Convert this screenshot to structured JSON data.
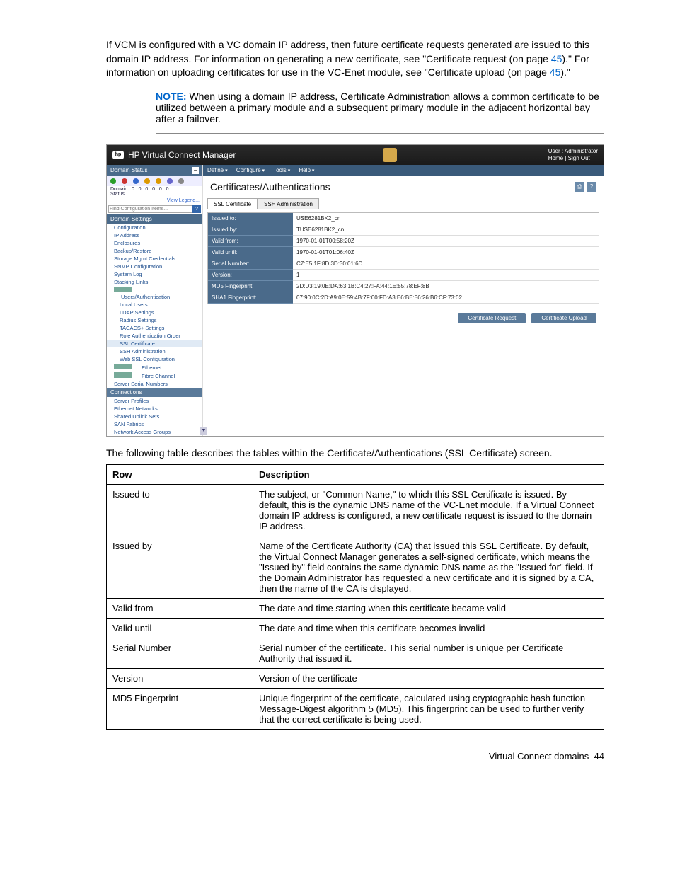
{
  "intro": {
    "p1a": "If VCM is configured with a VC domain IP address, then future certificate requests generated are issued to this domain IP address. For information on generating a new certificate, see \"Certificate request (on page ",
    "p1_ref1": "45",
    "p1b": ").\" For information on uploading certificates for use in the VC-Enet module, see \"Certificate upload (on page ",
    "p1_ref2": "45",
    "p1c": ").\""
  },
  "note": {
    "label": "NOTE:",
    "text": "  When using a domain IP address, Certificate Administration allows a common certificate to be utilized between a primary module and a subsequent primary module in the adjacent horizontal bay after a failover."
  },
  "shot": {
    "title": "HP Virtual Connect Manager",
    "user_label": "User : Administrator",
    "home": "Home",
    "signout": "Sign Out",
    "sidebar": {
      "status_hdr": "Domain Status",
      "domain_label": "Domain Status",
      "legend": "View Legend...",
      "search_ph": "Find Configuration Items...",
      "settings_hdr": "Domain Settings",
      "items": [
        "Configuration",
        "IP Address",
        "Enclosures",
        "Backup/Restore",
        "Storage Mgmt Credentials",
        "SNMP Configuration",
        "System Log",
        "Stacking Links"
      ],
      "users_hdr": "Users/Authentication",
      "users": [
        "Local Users",
        "LDAP Settings",
        "Radius Settings",
        "TACACS+ Settings",
        "Role Authentication Order",
        "SSL Certificate",
        "SSH Administration",
        "Web SSL Configuration"
      ],
      "eth": "Ethernet",
      "fc": "Fibre Channel",
      "ssn": "Server Serial Numbers",
      "conn_hdr": "Connections",
      "conn": [
        "Server Profiles",
        "Ethernet Networks",
        "Shared Uplink Sets",
        "SAN Fabrics",
        "Network Access Groups"
      ]
    },
    "menus": [
      "Define",
      "Configure",
      "Tools",
      "Help"
    ],
    "page_title": "Certificates/Authentications",
    "tabs": [
      "SSL Certificate",
      "SSH Administration"
    ],
    "cert": [
      {
        "l": "Issued to:",
        "v": "USE6281BK2_cn"
      },
      {
        "l": "Issued by:",
        "v": "TUSE6281BK2_cn"
      },
      {
        "l": "Valid from:",
        "v": "1970-01-01T00:58:20Z"
      },
      {
        "l": "Valid until:",
        "v": "1970-01-01T01:06:40Z"
      },
      {
        "l": "Serial Number:",
        "v": "C7:E5:1F:8D:3D:30:01:6D"
      },
      {
        "l": "Version:",
        "v": "1"
      },
      {
        "l": "MD5 Fingerprint:",
        "v": "2D:D3:19:0E:DA:63:1B:C4:27:FA:44:1E:55:78:EF:8B"
      },
      {
        "l": "SHA1 Fingerprint:",
        "v": "07:90:0C:2D:A9:0E:59:4B:7F:00:FD:A3:E6:BE:56:26:B6:CF:73:02"
      }
    ],
    "btn_req": "Certificate Request",
    "btn_up": "Certificate Upload"
  },
  "table_intro": "The following table describes the tables within the Certificate/Authentications (SSL Certificate) screen.",
  "desc": {
    "h1": "Row",
    "h2": "Description",
    "rows": [
      {
        "r": "Issued to",
        "d": "The subject, or \"Common Name,\" to which this SSL Certificate is issued. By default, this is the dynamic DNS name of the VC-Enet module. If a Virtual Connect domain IP address is configured, a new certificate request is issued to the domain IP address."
      },
      {
        "r": "Issued by",
        "d": "Name of the Certificate Authority (CA) that issued this SSL Certificate. By default, the Virtual Connect Manager generates a self-signed certificate, which means the \"Issued by\" field contains the same dynamic DNS name as the \"Issued for\" field. If the Domain Administrator has requested a new certificate and it is signed by a CA, then the name of the CA is displayed."
      },
      {
        "r": "Valid from",
        "d": "The date and time starting when this certificate became valid"
      },
      {
        "r": "Valid until",
        "d": "The date and time when this certificate becomes invalid"
      },
      {
        "r": "Serial Number",
        "d": "Serial number of the certificate. This serial number is unique per Certificate Authority that issued it."
      },
      {
        "r": "Version",
        "d": "Version of the certificate"
      },
      {
        "r": "MD5 Fingerprint",
        "d": "Unique fingerprint of the certificate, calculated using cryptographic hash function Message-Digest algorithm 5 (MD5). This fingerprint can be used to further verify that the correct certificate is being used."
      }
    ]
  },
  "footer": {
    "section": "Virtual Connect domains",
    "page": "44"
  }
}
